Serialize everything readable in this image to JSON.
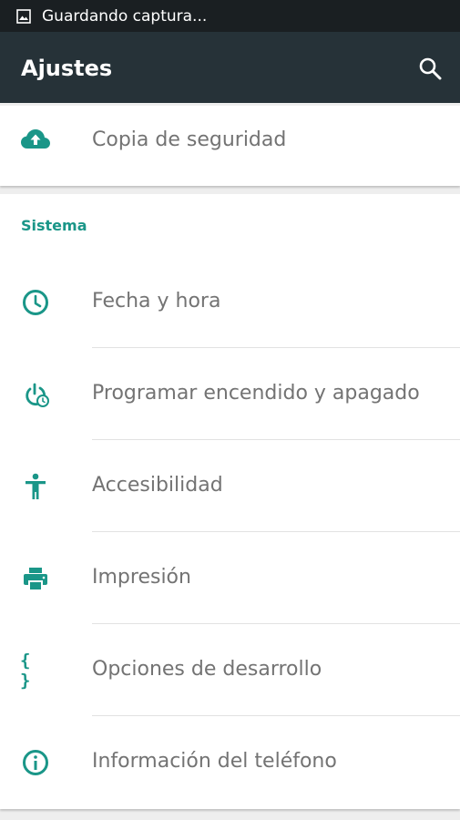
{
  "status_bar": {
    "notification_text": "Guardando captura..."
  },
  "app_bar": {
    "title": "Ajustes",
    "search_icon": "search-icon"
  },
  "backup": {
    "label": "Copia de seguridad",
    "icon": "cloud-upload-icon"
  },
  "system": {
    "header": "Sistema",
    "items": [
      {
        "label": "Fecha y hora",
        "icon": "clock-icon"
      },
      {
        "label": "Programar encendido y apagado",
        "icon": "power-schedule-icon"
      },
      {
        "label": "Accesibilidad",
        "icon": "accessibility-icon"
      },
      {
        "label": "Impresión",
        "icon": "printer-icon"
      },
      {
        "label": "Opciones de desarrollo",
        "icon": "braces-icon",
        "glyph": "{ }"
      },
      {
        "label": "Información del teléfono",
        "icon": "info-icon"
      }
    ]
  },
  "colors": {
    "accent": "#1a9688",
    "toolbar": "#263238",
    "status_bar": "#1a1f22",
    "label_text": "#737373",
    "background": "#eeeeee"
  }
}
